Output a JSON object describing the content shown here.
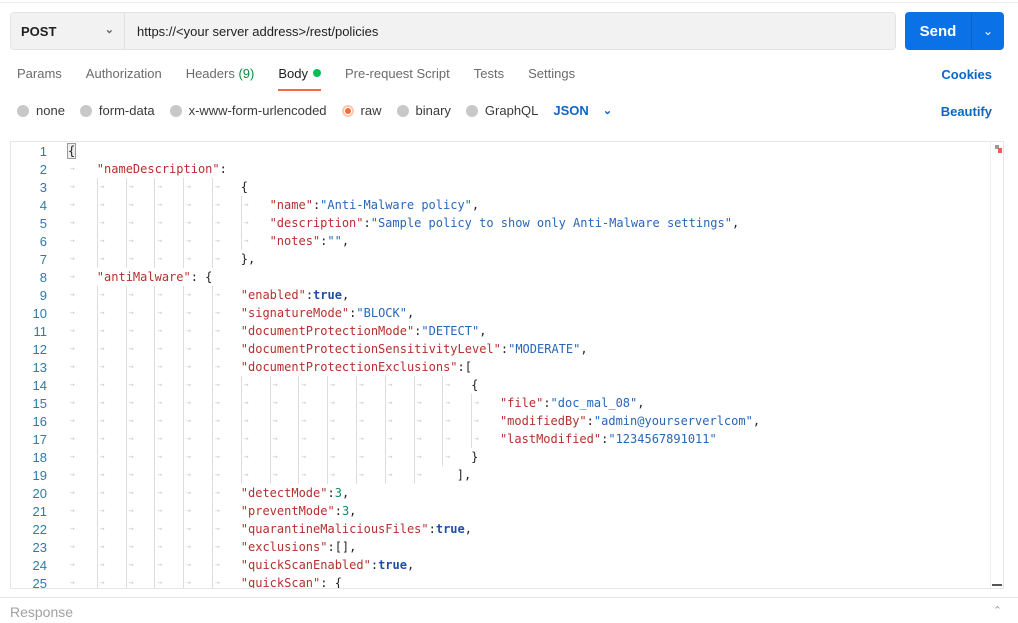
{
  "request": {
    "method": "POST",
    "url": "https://<your server address>/rest/policies",
    "send_label": "Send"
  },
  "tabs": [
    {
      "label": "Params"
    },
    {
      "label": "Authorization"
    },
    {
      "label": "Headers",
      "count": "(9)"
    },
    {
      "label": "Body",
      "active": true
    },
    {
      "label": "Pre-request Script"
    },
    {
      "label": "Tests"
    },
    {
      "label": "Settings"
    }
  ],
  "cookies_label": "Cookies",
  "body_types": [
    {
      "label": "none"
    },
    {
      "label": "form-data"
    },
    {
      "label": "x-www-form-urlencoded"
    },
    {
      "label": "raw",
      "selected": true
    },
    {
      "label": "binary"
    },
    {
      "label": "GraphQL"
    }
  ],
  "language": "JSON",
  "beautify_label": "Beautify",
  "colors": {
    "accent": "#0a72e6",
    "active_tab": "#f26b3a",
    "key": "#b5302e",
    "string": "#2767b8",
    "number": "#148a60"
  },
  "code": [
    {
      "n": "1",
      "indent": 0,
      "t": [
        [
          "p",
          "{"
        ]
      ]
    },
    {
      "n": "2",
      "indent": 1,
      "t": [
        [
          "k",
          "\"nameDescription\""
        ],
        [
          "p",
          ":"
        ]
      ]
    },
    {
      "n": "3",
      "indent": 6,
      "t": [
        [
          "p",
          "{"
        ]
      ]
    },
    {
      "n": "4",
      "indent": 7,
      "t": [
        [
          "k",
          "\"name\""
        ],
        [
          "p",
          ":"
        ],
        [
          "s",
          "\"Anti-Malware policy\""
        ],
        [
          "p",
          ","
        ]
      ]
    },
    {
      "n": "5",
      "indent": 7,
      "t": [
        [
          "k",
          "\"description\""
        ],
        [
          "p",
          ":"
        ],
        [
          "s",
          "\"Sample policy to show only Anti-Malware settings\""
        ],
        [
          "p",
          ","
        ]
      ]
    },
    {
      "n": "6",
      "indent": 7,
      "t": [
        [
          "k",
          "\"notes\""
        ],
        [
          "p",
          ":"
        ],
        [
          "s",
          "\"\""
        ],
        [
          "p",
          ","
        ]
      ]
    },
    {
      "n": "7",
      "indent": 6,
      "t": [
        [
          "p",
          "},"
        ]
      ]
    },
    {
      "n": "8",
      "indent": 1,
      "t": [
        [
          "k",
          "\"antiMalware\""
        ],
        [
          "p",
          ": {"
        ]
      ]
    },
    {
      "n": "9",
      "indent": 6,
      "t": [
        [
          "k",
          "\"enabled\""
        ],
        [
          "p",
          ":"
        ],
        [
          "b",
          "true"
        ],
        [
          "p",
          ","
        ]
      ]
    },
    {
      "n": "10",
      "indent": 6,
      "t": [
        [
          "k",
          "\"signatureMode\""
        ],
        [
          "p",
          ":"
        ],
        [
          "s",
          "\"BLOCK\""
        ],
        [
          "p",
          ","
        ]
      ]
    },
    {
      "n": "11",
      "indent": 6,
      "t": [
        [
          "k",
          "\"documentProtectionMode\""
        ],
        [
          "p",
          ":"
        ],
        [
          "s",
          "\"DETECT\""
        ],
        [
          "p",
          ","
        ]
      ]
    },
    {
      "n": "12",
      "indent": 6,
      "t": [
        [
          "k",
          "\"documentProtectionSensitivityLevel\""
        ],
        [
          "p",
          ":"
        ],
        [
          "s",
          "\"MODERATE\""
        ],
        [
          "p",
          ","
        ]
      ]
    },
    {
      "n": "13",
      "indent": 6,
      "t": [
        [
          "k",
          "\"documentProtectionExclusions\""
        ],
        [
          "p",
          ":["
        ]
      ]
    },
    {
      "n": "14",
      "indent": 14,
      "t": [
        [
          "p",
          "{"
        ]
      ]
    },
    {
      "n": "15",
      "indent": 15,
      "t": [
        [
          "k",
          "\"file\""
        ],
        [
          "p",
          ":"
        ],
        [
          "s",
          "\"doc_mal_08\""
        ],
        [
          "p",
          ","
        ]
      ]
    },
    {
      "n": "16",
      "indent": 15,
      "t": [
        [
          "k",
          "\"modifiedBy\""
        ],
        [
          "p",
          ":"
        ],
        [
          "s",
          "\"admin@yourserverlcom\""
        ],
        [
          "p",
          ","
        ]
      ]
    },
    {
      "n": "17",
      "indent": 15,
      "t": [
        [
          "k",
          "\"lastModified\""
        ],
        [
          "p",
          ":"
        ],
        [
          "s",
          "\"1234567891011\""
        ]
      ]
    },
    {
      "n": "18",
      "indent": 14,
      "t": [
        [
          "p",
          "}"
        ]
      ]
    },
    {
      "n": "19",
      "indent": 13,
      "t": [
        [
          "p",
          "  ],"
        ]
      ]
    },
    {
      "n": "20",
      "indent": 6,
      "t": [
        [
          "k",
          "\"detectMode\""
        ],
        [
          "p",
          ":"
        ],
        [
          "n",
          "3"
        ],
        [
          "p",
          ","
        ]
      ]
    },
    {
      "n": "21",
      "indent": 6,
      "t": [
        [
          "k",
          "\"preventMode\""
        ],
        [
          "p",
          ":"
        ],
        [
          "n",
          "3"
        ],
        [
          "p",
          ","
        ]
      ]
    },
    {
      "n": "22",
      "indent": 6,
      "t": [
        [
          "k",
          "\"quarantineMaliciousFiles\""
        ],
        [
          "p",
          ":"
        ],
        [
          "b",
          "true"
        ],
        [
          "p",
          ","
        ]
      ]
    },
    {
      "n": "23",
      "indent": 6,
      "t": [
        [
          "k",
          "\"exclusions\""
        ],
        [
          "p",
          ":[],"
        ]
      ]
    },
    {
      "n": "24",
      "indent": 6,
      "t": [
        [
          "k",
          "\"quickScanEnabled\""
        ],
        [
          "p",
          ":"
        ],
        [
          "b",
          "true"
        ],
        [
          "p",
          ","
        ]
      ]
    },
    {
      "n": "25",
      "indent": 6,
      "t": [
        [
          "k",
          "\"quickScan\""
        ],
        [
          "p",
          ": {"
        ]
      ]
    }
  ],
  "response_label": "Response"
}
